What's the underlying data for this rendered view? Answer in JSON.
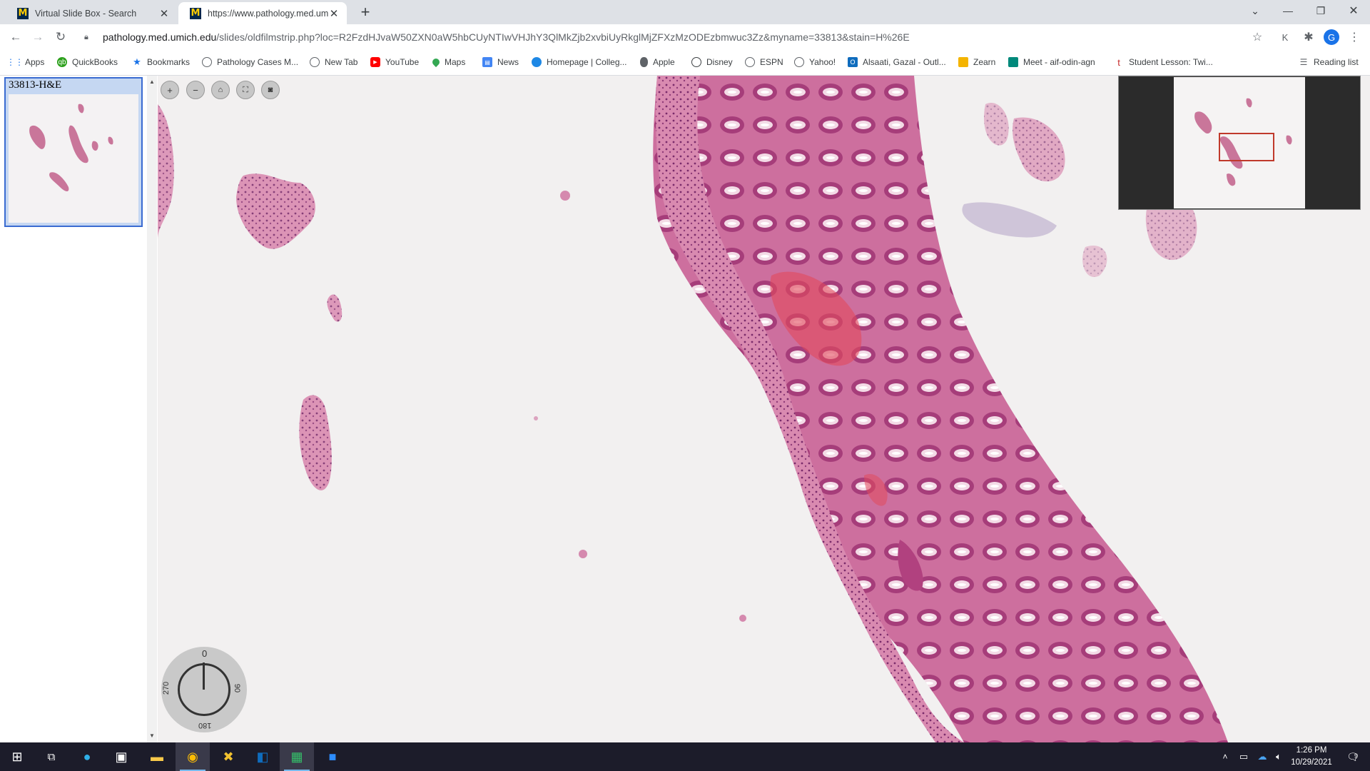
{
  "browser": {
    "tabs": [
      {
        "title": "Virtual Slide Box - Search",
        "active": false
      },
      {
        "title": "https://www.pathology.med.umich",
        "active": true
      }
    ],
    "url_domain": "pathology.med.umich.edu",
    "url_path": "/slides/oldfilmstrip.php?loc=R2FzdHJvaW50ZXN0aW5hbCUyNTIwVHJhY3QlMkZjb2xvbiUyRkglMjZFXzMzODEzbmwuc3Zz&myname=33813&stain=H%26E",
    "new_tab_label": "+"
  },
  "bookmarks": [
    {
      "label": "Apps",
      "icon": "apps-grid-icon"
    },
    {
      "label": "QuickBooks",
      "icon": "quickbooks-icon"
    },
    {
      "label": "Bookmarks",
      "icon": "star-icon"
    },
    {
      "label": "Pathology Cases M...",
      "icon": "globe-icon"
    },
    {
      "label": "New Tab",
      "icon": "globe-icon"
    },
    {
      "label": "YouTube",
      "icon": "youtube-icon"
    },
    {
      "label": "Maps",
      "icon": "maps-pin-icon"
    },
    {
      "label": "News",
      "icon": "news-icon"
    },
    {
      "label": "Homepage | Colleg...",
      "icon": "college-icon"
    },
    {
      "label": "Apple",
      "icon": "apple-icon"
    },
    {
      "label": "Disney",
      "icon": "disney-icon"
    },
    {
      "label": "ESPN",
      "icon": "globe-icon"
    },
    {
      "label": "Yahoo!",
      "icon": "globe-icon"
    },
    {
      "label": "Alsaati, Gazal - Outl...",
      "icon": "outlook-icon"
    },
    {
      "label": "Zearn",
      "icon": "zearn-icon"
    },
    {
      "label": "Meet - aif-odin-agn",
      "icon": "meet-icon"
    },
    {
      "label": "Student Lesson: Twi...",
      "icon": "lesson-icon"
    }
  ],
  "reading_list_label": "Reading list",
  "profile_initial": "G",
  "filmstrip": {
    "slide_label": "33813-H&E"
  },
  "viewer": {
    "rotation_labels": {
      "top": "0",
      "right": "90",
      "bottom": "180",
      "left": "270"
    }
  },
  "taskbar": {
    "time": "1:26 PM",
    "date": "10/29/2021",
    "notification_count": "9"
  },
  "colors": {
    "tissue_pink": "#d47ea6",
    "tissue_dark": "#b1417f",
    "blood_red": "#e24a5c",
    "slide_background": "#f2f0f0",
    "nav_box": "#c0392b"
  }
}
